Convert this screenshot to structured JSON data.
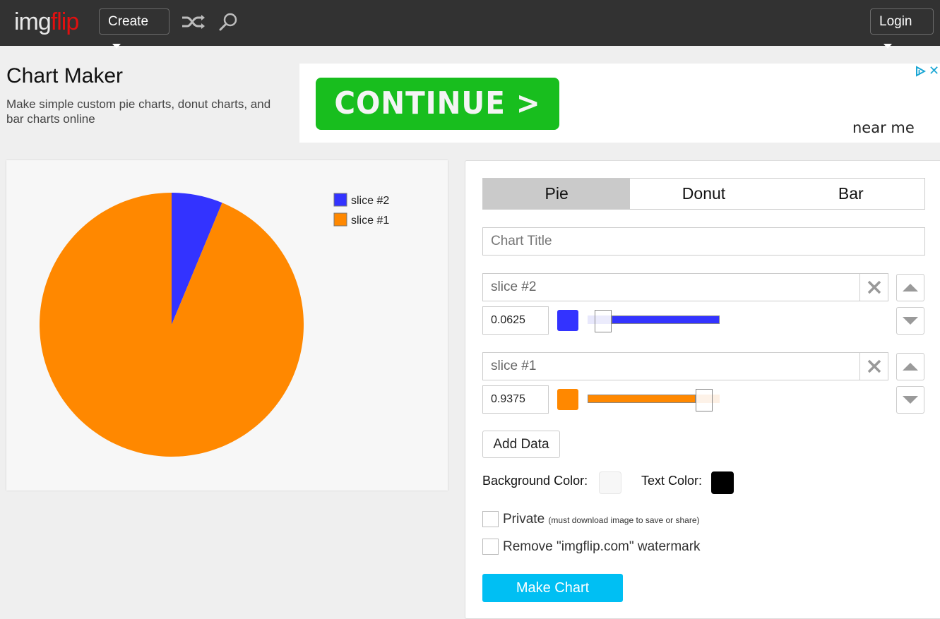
{
  "header": {
    "logo_part1": "img",
    "logo_part2": "flip",
    "create_label": "Create",
    "login_label": "Login",
    "icons": [
      "shuffle-icon",
      "search-icon"
    ]
  },
  "page": {
    "title": "Chart Maker",
    "subtitle": "Make simple custom pie charts, donut charts, and bar charts online"
  },
  "ad": {
    "cta_label": "CONTINUE >",
    "caption": "near me",
    "icons": [
      "ad-choices-icon",
      "close-icon"
    ],
    "close_glyph": "✕"
  },
  "tabs": [
    {
      "label": "Pie",
      "active": true
    },
    {
      "label": "Donut",
      "active": false
    },
    {
      "label": "Bar",
      "active": false
    }
  ],
  "form": {
    "chart_title_placeholder": "Chart Title",
    "chart_title_value": "",
    "rows": [
      {
        "name": "slice #2",
        "value": "0.0625",
        "color": "#3333ff",
        "empty_color": "#e8e8fc",
        "fraction": 0.0625
      },
      {
        "name": "slice #1",
        "value": "0.9375",
        "color": "#ff8800",
        "empty_color": "#fdf0e4",
        "fraction": 0.9375
      }
    ],
    "add_data_label": "Add Data",
    "background_color_label": "Background Color:",
    "background_color": "#f7f7f7",
    "text_color_label": "Text Color:",
    "text_color": "#000000",
    "private_label": "Private",
    "private_note": "(must download image to save or share)",
    "private_checked": false,
    "watermark_label": "Remove \"imgflip.com\" watermark",
    "watermark_checked": false,
    "make_chart_label": "Make Chart"
  },
  "chart_data": {
    "type": "pie",
    "title": "",
    "categories": [
      "slice #2",
      "slice #1"
    ],
    "values": [
      0.0625,
      0.9375
    ],
    "colors": [
      "#3333ff",
      "#ff8800"
    ],
    "legend": [
      "slice #2",
      "slice #1"
    ],
    "legend_position": "top-right",
    "background": "#f7f7f7",
    "text_color": "#000000"
  }
}
